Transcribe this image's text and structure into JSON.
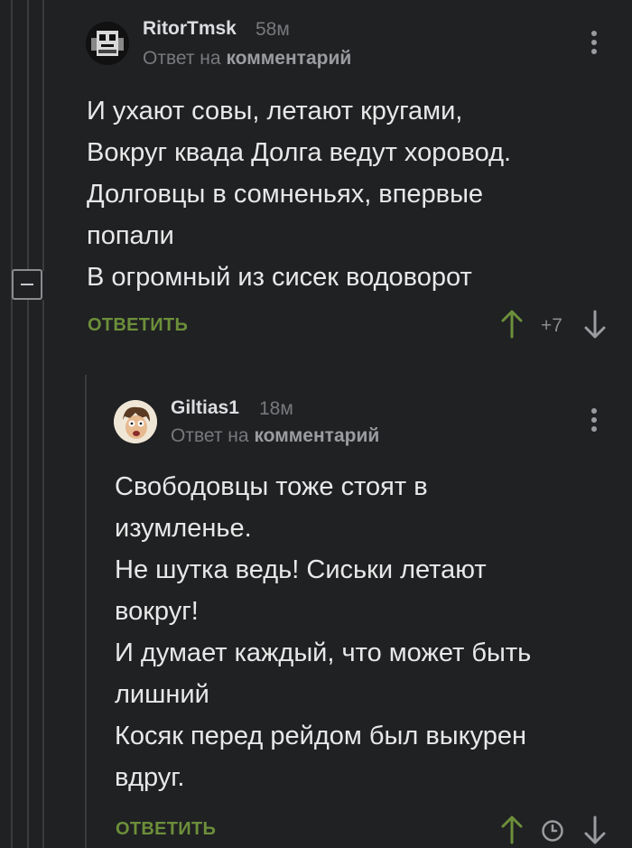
{
  "comments": [
    {
      "username": "RitorTmsk",
      "time": "58м",
      "reply_prefix": "Ответ на",
      "reply_link": "комментарий",
      "lines": [
        "И ухают совы, летают кругами,",
        "Вокруг квада Долга ведут хоровод.",
        "Долговцы в сомненьях, впервые",
        "попали",
        "В огромный из сисек водоворот"
      ],
      "reply_label": "ОТВЕТИТЬ",
      "rating": "+7"
    },
    {
      "username": "Giltias1",
      "time": "18м",
      "reply_prefix": "Ответ на",
      "reply_link": "комментарий",
      "lines": [
        "Свободовцы тоже стоят в",
        "изумленье.",
        "Не шутка ведь! Сиськи летают",
        "вокруг!",
        "И думает каждый, что может быть",
        "лишний",
        "Косяк перед рейдом был выкурен",
        "вдруг."
      ],
      "reply_label": "ОТВЕТИТЬ"
    }
  ],
  "colors": {
    "background": "#202123",
    "accent_green": "#6c8f3a",
    "muted": "#77797c"
  }
}
